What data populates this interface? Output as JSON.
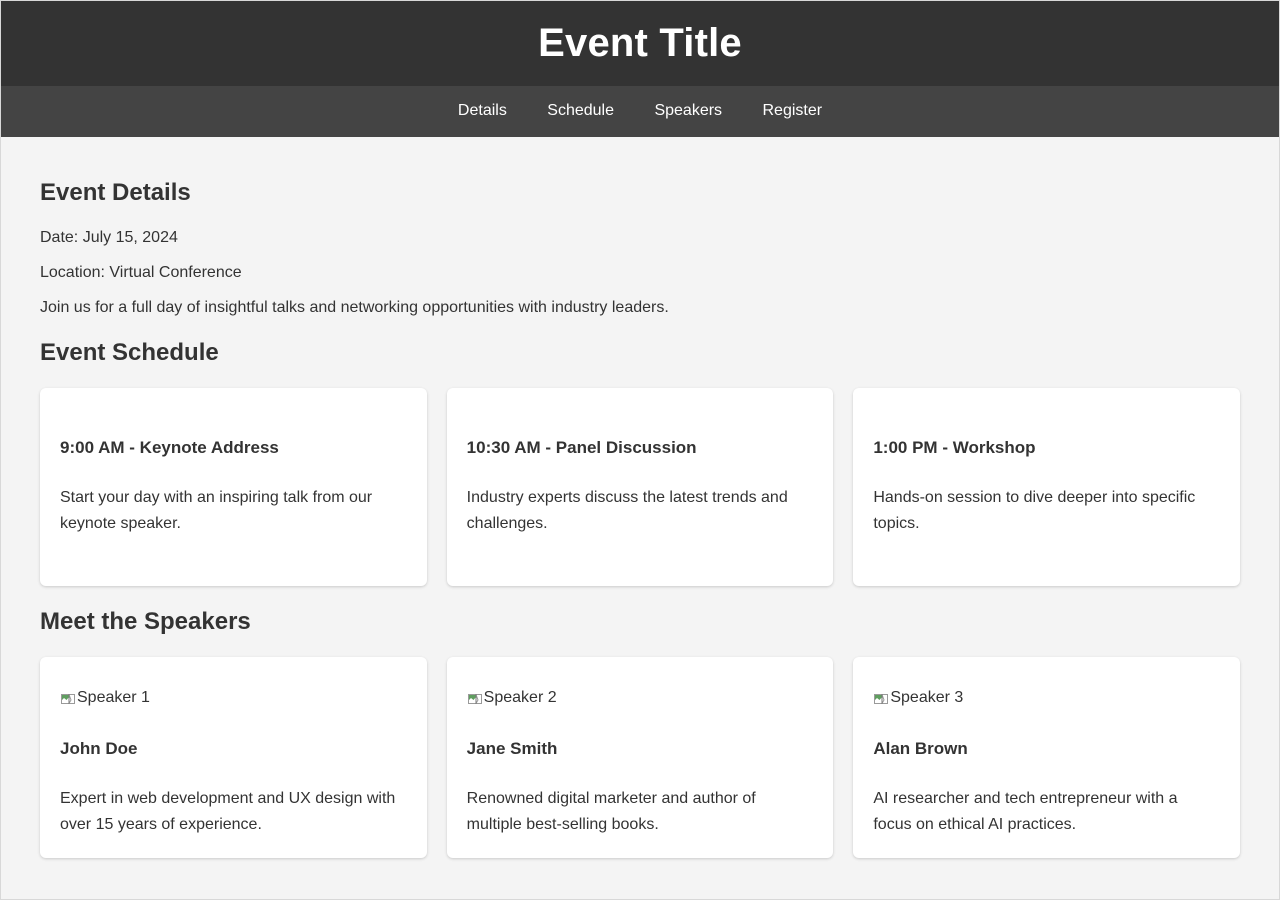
{
  "header": {
    "title": "Event Title"
  },
  "nav": {
    "items": [
      {
        "label": "Details"
      },
      {
        "label": "Schedule"
      },
      {
        "label": "Speakers"
      },
      {
        "label": "Register"
      }
    ]
  },
  "details": {
    "heading": "Event Details",
    "date": "Date: July 15, 2024",
    "location": "Location: Virtual Conference",
    "description": "Join us for a full day of insightful talks and networking opportunities with industry leaders."
  },
  "schedule": {
    "heading": "Event Schedule",
    "items": [
      {
        "time_title": "9:00 AM - Keynote Address",
        "description": "Start your day with an inspiring talk from our keynote speaker."
      },
      {
        "time_title": "10:30 AM - Panel Discussion",
        "description": "Industry experts discuss the latest trends and challenges."
      },
      {
        "time_title": "1:00 PM - Workshop",
        "description": "Hands-on session to dive deeper into specific topics."
      }
    ]
  },
  "speakers": {
    "heading": "Meet the Speakers",
    "items": [
      {
        "image_alt": "Speaker 1",
        "image_icon": "broken-image-icon",
        "name": "John Doe",
        "bio": "Expert in web development and UX design with over 15 years of experience."
      },
      {
        "image_alt": "Speaker 2",
        "image_icon": "broken-image-icon",
        "name": "Jane Smith",
        "bio": "Renowned digital marketer and author of multiple best-selling books."
      },
      {
        "image_alt": "Speaker 3",
        "image_icon": "broken-image-icon",
        "name": "Alan Brown",
        "bio": "AI researcher and tech entrepreneur with a focus on ethical AI practices."
      }
    ]
  },
  "colors": {
    "header_bg": "#333333",
    "nav_bg": "#444444",
    "page_bg": "#f4f4f4",
    "card_bg": "#ffffff",
    "text": "#333333",
    "nav_text": "#ffffff"
  }
}
